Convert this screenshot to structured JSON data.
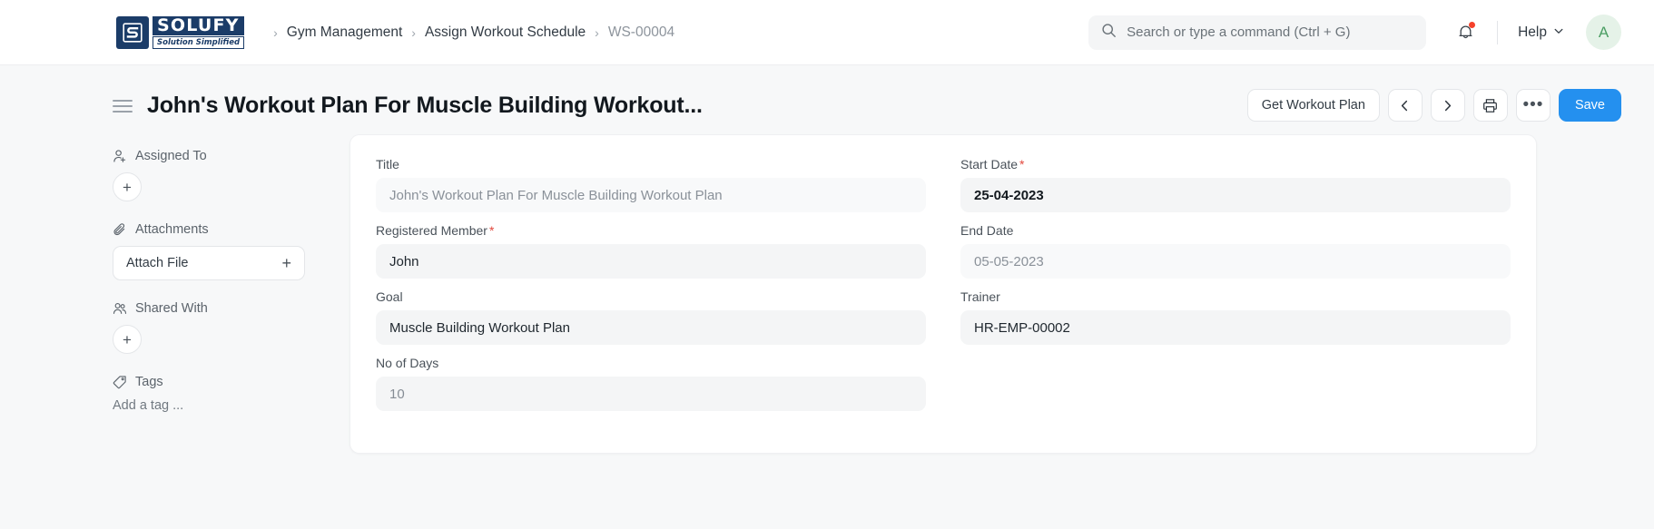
{
  "navbar": {
    "logo": {
      "name": "SOLUFY",
      "tagline": "Solution Simplified",
      "mark_letter": "S"
    },
    "breadcrumb": [
      {
        "label": "Gym Management",
        "current": false
      },
      {
        "label": "Assign Workout Schedule",
        "current": false
      },
      {
        "label": "WS-00004",
        "current": true
      }
    ],
    "separator": "›",
    "search": {
      "value": "",
      "placeholder": "Search or type a command (Ctrl + G)",
      "icon": "search-icon"
    },
    "notifications": {
      "icon": "bell-icon",
      "has_unread": true,
      "dot_color": "#F5412B"
    },
    "help": {
      "label": "Help",
      "icon": "chevron-down-icon"
    },
    "avatar": {
      "initial": "A",
      "bg": "#E5F2E8",
      "fg": "#4C9E64"
    }
  },
  "page": {
    "title": "John's Workout Plan For Muscle Building Workout...",
    "sidebar_toggle_icon": "hamburger-icon",
    "actions": {
      "get_workout_plan": "Get Workout Plan",
      "prev": "‹",
      "next": "›",
      "print_icon": "printer-icon",
      "more": "•••",
      "save": "Save",
      "save_color": "#2490EF"
    }
  },
  "side_panel": {
    "assigned_to": {
      "label": "Assigned To",
      "icon": "user-plus-icon",
      "add": "+"
    },
    "attachments": {
      "label": "Attachments",
      "icon": "paperclip-icon",
      "button_label": "Attach File",
      "add": "+"
    },
    "shared_with": {
      "label": "Shared With",
      "icon": "users-icon",
      "add": "+"
    },
    "tags": {
      "label": "Tags",
      "icon": "tag-icon",
      "placeholder": "Add a tag ..."
    }
  },
  "form": {
    "left": [
      {
        "label": "Title",
        "required": false,
        "value": "John's Workout Plan For Muscle Building Workout Plan",
        "style": "muted"
      },
      {
        "label": "Registered Member",
        "required": true,
        "value": "John",
        "style": "normal"
      },
      {
        "label": "Goal",
        "required": false,
        "value": "Muscle Building Workout Plan",
        "style": "normal"
      },
      {
        "label": "No of Days",
        "required": false,
        "value": "10",
        "style": "dim"
      }
    ],
    "right": [
      {
        "label": "Start Date",
        "required": true,
        "value": "25-04-2023",
        "style": "strong"
      },
      {
        "label": "End Date",
        "required": false,
        "value": "05-05-2023",
        "style": "muted"
      },
      {
        "label": "Trainer",
        "required": false,
        "value": "HR-EMP-00002",
        "style": "normal"
      }
    ]
  }
}
